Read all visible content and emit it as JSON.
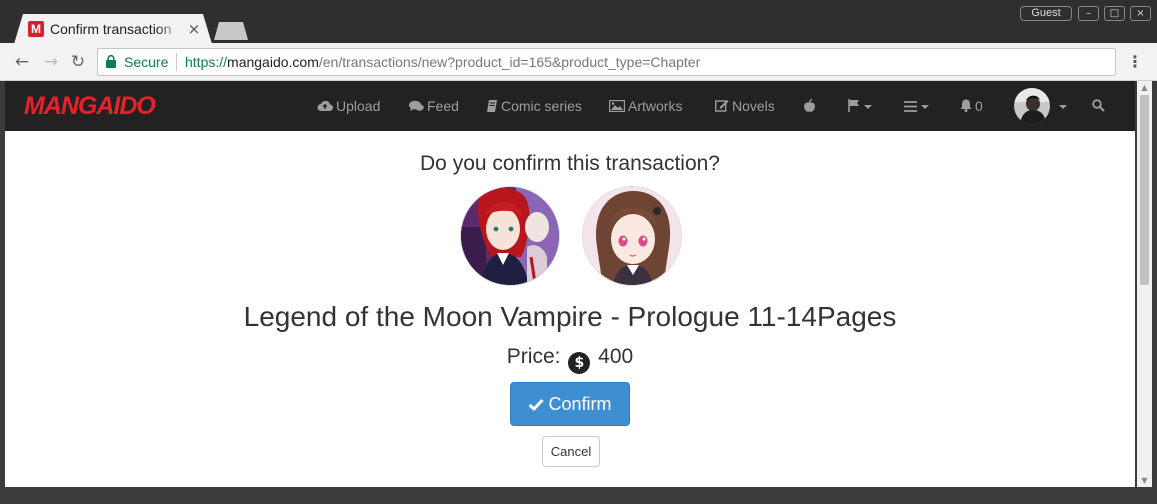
{
  "browser": {
    "tab_title": "Confirm transaction",
    "tab_favicon_letter": "M",
    "profile_label": "Guest",
    "secure_label": "Secure",
    "url_scheme": "https://",
    "url_host": "mangaido.com",
    "url_path": "/en/transactions/new?product_id=165&product_type=Chapter"
  },
  "site_nav": {
    "logo": "MANGAIDO",
    "items": [
      {
        "label": "Upload",
        "icon": "cloud-upload-icon"
      },
      {
        "label": "Feed",
        "icon": "comments-icon"
      },
      {
        "label": "Comic series",
        "icon": "book-icon"
      },
      {
        "label": "Artworks",
        "icon": "picture-icon"
      },
      {
        "label": "Novels",
        "icon": "edit-icon"
      }
    ],
    "notifications_count": "0"
  },
  "main": {
    "question": "Do you confirm this transaction?",
    "product_title": "Legend of the Moon Vampire - Prologue 11-14Pages",
    "price_label": "Price:",
    "price_value": "400",
    "currency_icon": "dollar-coin-icon",
    "confirm_label": "Confirm",
    "cancel_label": "Cancel"
  },
  "colors": {
    "brand": "#e8202b",
    "navbar": "#222222",
    "primary_button": "#3d8fd1",
    "secure_green": "#0b8043"
  }
}
